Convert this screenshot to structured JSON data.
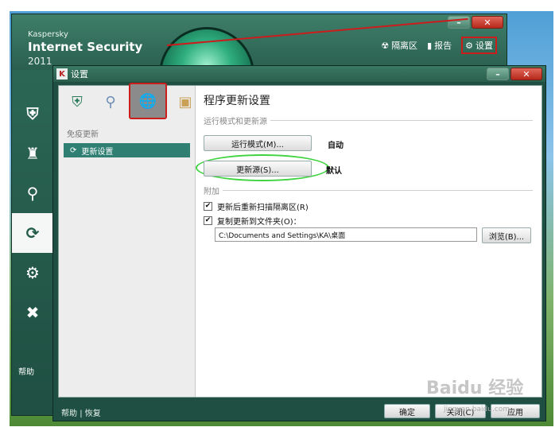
{
  "app": {
    "brand_small": "Kaspersky",
    "brand_big": "Internet Security",
    "brand_year": "2011",
    "top_links": [
      {
        "label": "隔离区",
        "icon": "biohazard-icon"
      },
      {
        "label": "报告",
        "icon": "bar-chart-icon"
      },
      {
        "label": "设置",
        "icon": "gear-icon"
      }
    ],
    "left_nav": [
      {
        "icon": "shield-icon",
        "glyph": "⛨"
      },
      {
        "icon": "castle-icon",
        "glyph": "♜"
      },
      {
        "icon": "search-icon",
        "glyph": "⚲"
      },
      {
        "icon": "refresh-icon",
        "glyph": "⟳",
        "active": true
      },
      {
        "icon": "support-icon",
        "glyph": "⚙"
      },
      {
        "icon": "tools-icon",
        "glyph": "✖"
      }
    ],
    "help": "帮助",
    "min_glyph": "–",
    "close_glyph": "✕"
  },
  "dialog": {
    "title": "设置",
    "title_icon_glyph": "K",
    "left": {
      "section_label": "免疫更新",
      "selected_item": "更新设置",
      "tabs": [
        {
          "icon": "shield-icon",
          "glyph": "⛨"
        },
        {
          "icon": "search-icon",
          "glyph": "⚲"
        },
        {
          "icon": "globe-icon",
          "glyph": "🌐",
          "active": true
        },
        {
          "icon": "box-icon",
          "glyph": "▣"
        }
      ]
    },
    "right": {
      "title": "程序更新设置",
      "group_run": "运行模式和更新源",
      "run_mode_button": "运行模式(M)...",
      "run_mode_value": "自动",
      "source_button": "更新源(S)...",
      "source_value": "默认",
      "group_extra": "附加",
      "chk_rescan": "更新后重新扫描隔离区(R)",
      "chk_copy": "复制更新到文件夹(O)：",
      "folder_path": "C:\\Documents and Settings\\KA\\桌面",
      "browse_button": "浏览(B)...",
      "check_glyph": "✔"
    },
    "footer": {
      "help": "帮助",
      "restore": "恢复",
      "ok": "确定",
      "close": "关闭(C)",
      "apply": "应用"
    }
  },
  "watermark": {
    "text": "Baidu 经验",
    "sub": "jingyan.baidu.com"
  },
  "colors": {
    "kav_green": "#1f4f42",
    "selected_item": "#2f7f73",
    "highlight_red": "#cc1c1c",
    "highlight_green": "#3fd33f"
  }
}
